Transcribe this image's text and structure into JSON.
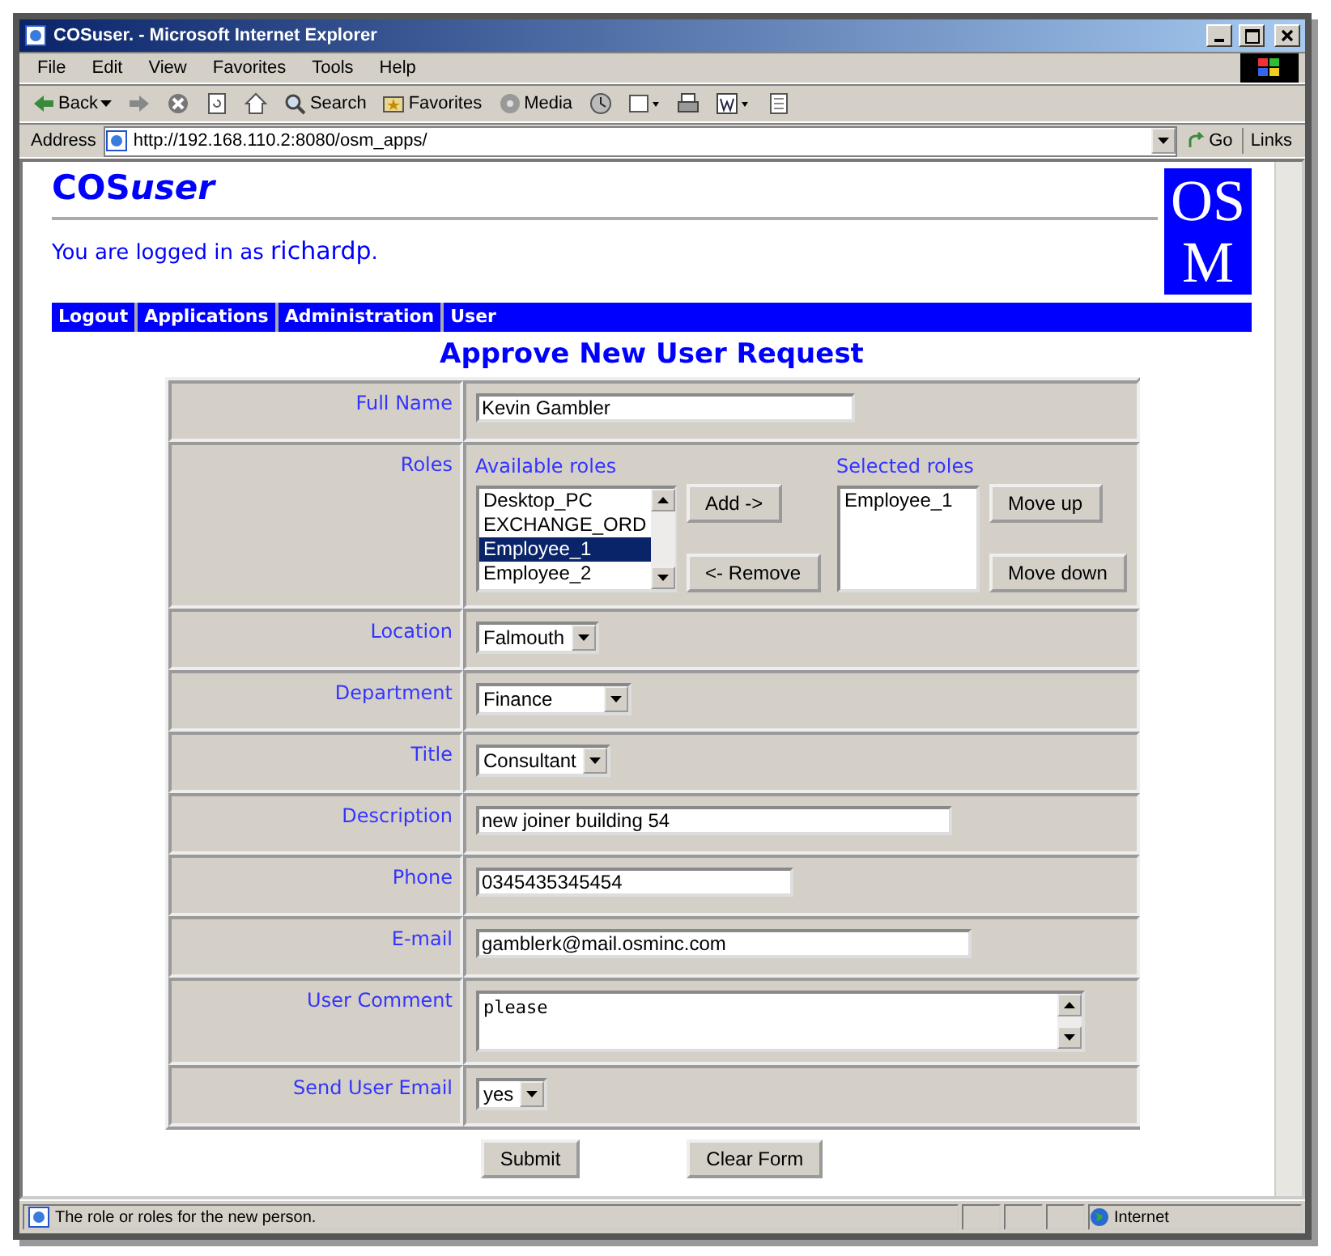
{
  "window": {
    "title": "COSuser. - Microsoft Internet Explorer"
  },
  "menu": [
    "File",
    "Edit",
    "View",
    "Favorites",
    "Tools",
    "Help"
  ],
  "toolbar": [
    {
      "kind": "back",
      "label": "Back"
    },
    {
      "kind": "forward"
    },
    {
      "kind": "stop"
    },
    {
      "kind": "refresh"
    },
    {
      "kind": "home"
    },
    {
      "kind": "search",
      "label": "Search"
    },
    {
      "kind": "favorites",
      "label": "Favorites"
    },
    {
      "kind": "media",
      "label": "Media"
    },
    {
      "kind": "history"
    },
    {
      "kind": "mail"
    },
    {
      "kind": "print"
    },
    {
      "kind": "edit"
    },
    {
      "kind": "discuss"
    }
  ],
  "address": {
    "label": "Address",
    "url": "http://192.168.110.2:8080/osm_apps/",
    "go": "Go",
    "links": "Links"
  },
  "brand": {
    "main": "COS",
    "accent": "user"
  },
  "login": "You are logged in as **richardp**.",
  "logo": [
    "OS",
    "M"
  ],
  "nav": [
    "Logout",
    "Applications",
    "Administration",
    "User"
  ],
  "heading": "Approve New User Request",
  "rows": [
    {
      "kind": "text",
      "label": "Full Name",
      "value": "Kevin Gambler"
    },
    {
      "kind": "roles",
      "label": "Roles",
      "available_label": "Available roles",
      "selected_label": "Selected roles",
      "available": [
        {
          "text": "Desktop_PC",
          "selected": false
        },
        {
          "text": "EXCHANGE_ORD",
          "selected": false
        },
        {
          "text": "Employee_1",
          "selected": true
        },
        {
          "text": "Employee_2",
          "selected": false
        }
      ],
      "chosen": [
        "Employee_1"
      ],
      "add": "Add ->",
      "remove": "<- Remove",
      "up": "Move up",
      "down": "Move down"
    },
    {
      "kind": "select",
      "label": "Location",
      "value": "Falmouth"
    },
    {
      "kind": "select",
      "label": "Department",
      "value": "Finance"
    },
    {
      "kind": "select",
      "label": "Title",
      "value": "Consultant"
    },
    {
      "kind": "text",
      "label": "Description",
      "value": "new joiner building 54"
    },
    {
      "kind": "text",
      "label": "Phone",
      "value": "0345435345454"
    },
    {
      "kind": "text",
      "label": "E-mail",
      "value": "gamblerk@mail.osminc.com"
    },
    {
      "kind": "textarea",
      "label": "User Comment",
      "value": "please"
    },
    {
      "kind": "select",
      "label": "Send User Email",
      "value": "yes"
    }
  ],
  "buttons": [
    "Submit",
    "Clear Form"
  ],
  "status": {
    "text": "The role or roles for the new person.",
    "zone": "Internet"
  }
}
